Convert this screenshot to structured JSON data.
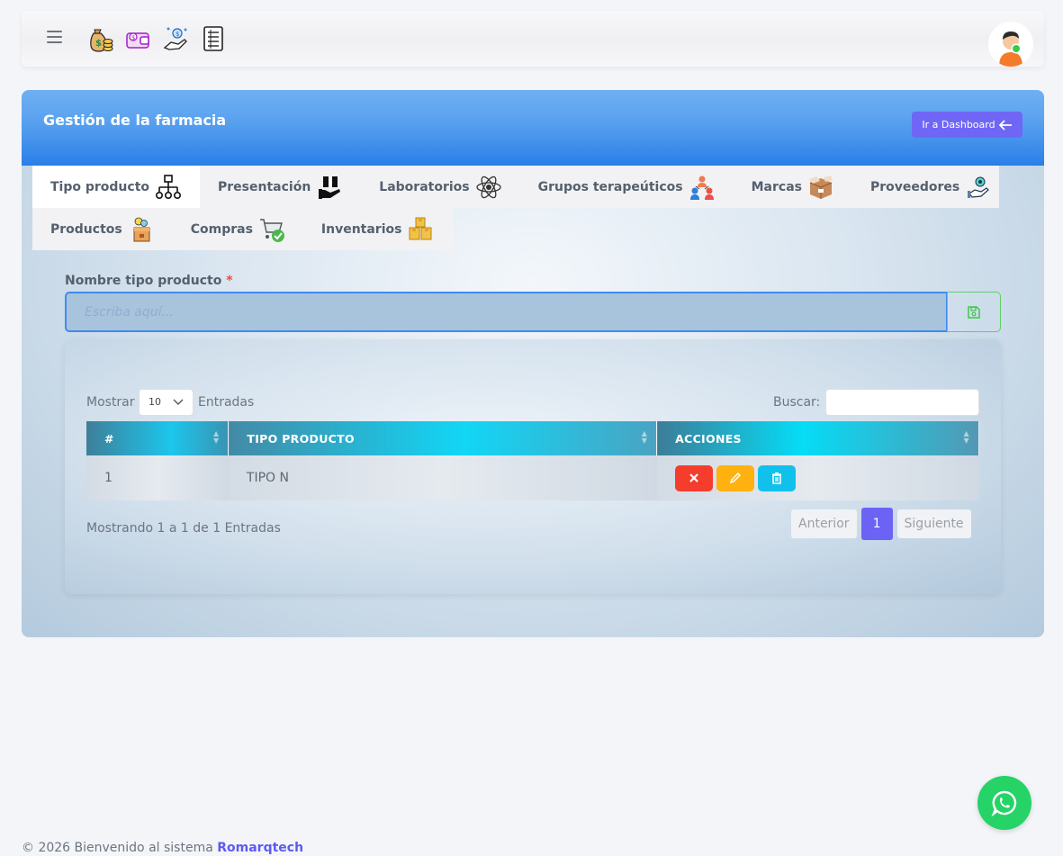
{
  "topbar": {
    "icons": [
      "money-bag-icon",
      "wallet-icon",
      "payment-hand-icon",
      "receipt-icon"
    ]
  },
  "card": {
    "title": "Gestión de la farmacia",
    "dashboard_label": "Ir a Dashboard"
  },
  "tabs": [
    {
      "label": "Tipo producto",
      "icon": "hierarchy-icon",
      "active": true
    },
    {
      "label": "Presentación",
      "icon": "box-hand-icon"
    },
    {
      "label": "Laboratorios",
      "icon": "atom-icon"
    },
    {
      "label": "Grupos terapeúticos",
      "icon": "group-icon"
    },
    {
      "label": "Marcas",
      "icon": "brand-box-icon"
    },
    {
      "label": "Proveedores",
      "icon": "supplier-hand-icon"
    },
    {
      "label": "Productos",
      "icon": "products-icon"
    },
    {
      "label": "Compras",
      "icon": "cart-check-icon"
    },
    {
      "label": "Inventarios",
      "icon": "boxes-icon"
    }
  ],
  "form": {
    "label": "Nombre tipo producto",
    "required_mark": "*",
    "placeholder": "Escriba aquí..."
  },
  "table": {
    "show_label": "Mostrar",
    "page_size": "10",
    "entries_label": "Entradas",
    "search_label": "Buscar:",
    "columns": [
      "#",
      "TIPO PRODUCTO",
      "ACCIONES"
    ],
    "rows": [
      {
        "num": "1",
        "tipo": "TIPO N"
      }
    ],
    "info": "Mostrando 1 a 1 de 1 Entradas",
    "pager": {
      "prev": "Anterior",
      "current": "1",
      "next": "Siguiente"
    }
  },
  "footer": {
    "text": "© 2026 Bienvenido al sistema",
    "brand": "Romarqtech"
  },
  "colors": {
    "header_blue": "#2a7fe8",
    "accent_purple": "#7066f5",
    "delete_red": "#f53d2d",
    "edit_yellow": "#ffb20f",
    "trash_cyan": "#12c0ec",
    "whatsapp_green": "#25d366"
  }
}
